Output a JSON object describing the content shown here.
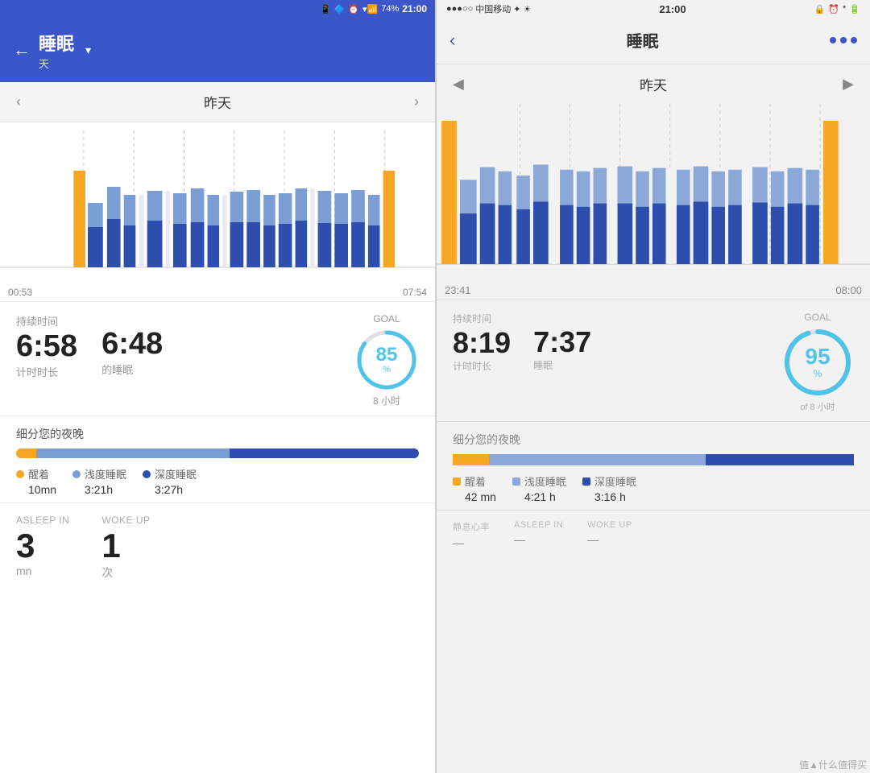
{
  "left": {
    "statusBar": {
      "battery": "74%",
      "time": "21:00",
      "icons": "📶"
    },
    "header": {
      "back": "←",
      "title": "睡眠",
      "subtitle": "天",
      "dropdown": "▾"
    },
    "nav": {
      "prev": "‹",
      "date": "昨天",
      "next": "›"
    },
    "chart": {
      "timeStart": "00:53",
      "timeEnd": "07:54"
    },
    "stats": {
      "durationLabel": "持续时间",
      "goalLabel": "GOAL",
      "value1": "6:58",
      "label1": "计时时长",
      "value2": "6:48",
      "label2": "的睡眠",
      "goalPercent": "85",
      "goalSublabel": "8 小时"
    },
    "breakdown": {
      "title": "细分您的夜晚",
      "awakeLabel": "醒着",
      "awakeValue": "10mn",
      "lightLabel": "浅度睡眠",
      "lightValue": "3:21h",
      "deepLabel": "深度睡眠",
      "deepValue": "3:27h",
      "awakeWidth": 5,
      "lightWidth": 48,
      "deepWidth": 47
    },
    "asleep": {
      "label1": "ASLEEP IN",
      "value1": "3",
      "unit1": "mn",
      "label2": "WOKE UP",
      "value2": "1",
      "unit2": "次"
    }
  },
  "right": {
    "statusBar": {
      "left": "●●●○○ 中国移动 ✦",
      "time": "21:00",
      "battery": "🔋"
    },
    "header": {
      "back": "‹",
      "title": "睡眠",
      "dots": [
        "●",
        "●",
        "●"
      ]
    },
    "nav": {
      "prev": "◀",
      "date": "昨天",
      "next": "▶"
    },
    "chart": {
      "timeStart": "23:41",
      "timeEnd": "08:00"
    },
    "stats": {
      "durationLabel": "持续时间",
      "goalLabel": "GOAL",
      "value1": "8:19",
      "label1": "计时时长",
      "value2": "7:37",
      "label2": "睡眠",
      "goalPercent": "95",
      "goalSublabel": "of 8 小时"
    },
    "breakdown": {
      "title": "细分您的夜晚",
      "awakeLabel": "醒着",
      "awakeValue": "42 mn",
      "lightLabel": "浅度睡眠",
      "lightValue": "4:21 h",
      "deepLabel": "深度睡眠",
      "deepValue": "3:16 h",
      "awakeWidth": 9,
      "lightWidth": 54,
      "deepWidth": 37
    },
    "bottom": {
      "label1": "静息心率",
      "value1": "—",
      "label2": "ASLEEP IN",
      "value2": "—",
      "label3": "WOKE UP",
      "value3": "—"
    },
    "watermark": "值▲什么值得买"
  }
}
